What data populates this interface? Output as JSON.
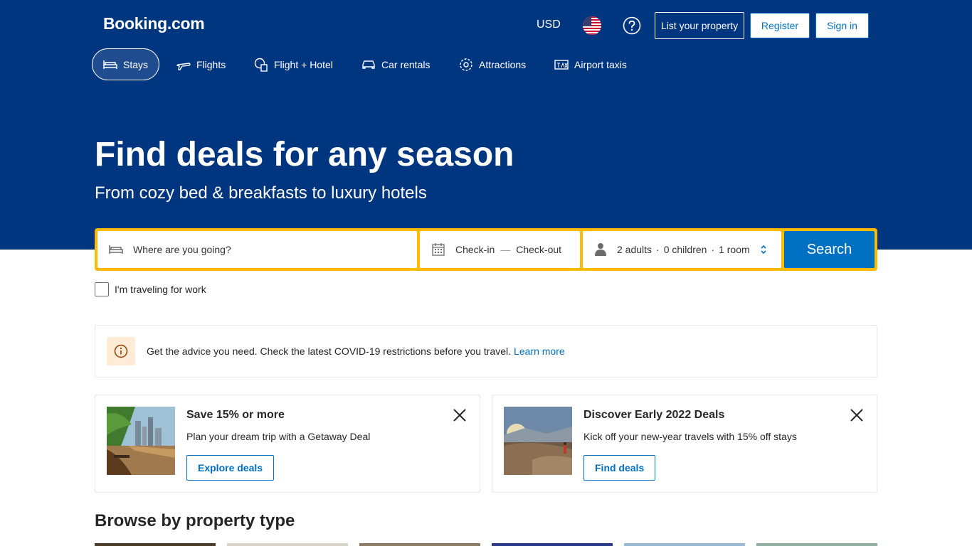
{
  "header": {
    "logo": "Booking.com",
    "currency": "USD",
    "list_property": "List your property",
    "register": "Register",
    "sign_in": "Sign in"
  },
  "nav": {
    "items": [
      {
        "label": "Stays",
        "icon": "bed-icon"
      },
      {
        "label": "Flights",
        "icon": "plane-icon"
      },
      {
        "label": "Flight + Hotel",
        "icon": "flight-hotel-icon"
      },
      {
        "label": "Car rentals",
        "icon": "car-icon"
      },
      {
        "label": "Attractions",
        "icon": "attractions-icon"
      },
      {
        "label": "Airport taxis",
        "icon": "taxi-icon"
      }
    ]
  },
  "hero": {
    "title": "Find deals for any season",
    "subtitle": "From cozy bed & breakfasts to luxury hotels"
  },
  "search": {
    "destination_placeholder": "Where are you going?",
    "checkin": "Check-in",
    "dash": "—",
    "checkout": "Check-out",
    "adults": "2 adults",
    "dot1": "·",
    "children": "0 children",
    "dot2": "·",
    "rooms": "1 room",
    "button": "Search"
  },
  "work_travel": {
    "label": "I'm traveling for work"
  },
  "covid": {
    "text": "Get the advice you need. Check the latest COVID-19 restrictions before you travel.",
    "link": "Learn more"
  },
  "cards": [
    {
      "title": "Save 15% or more",
      "desc": "Plan your dream trip with a Getaway Deal",
      "button": "Explore deals"
    },
    {
      "title": "Discover Early 2022 Deals",
      "desc": "Kick off your new-year travels with 15% off stays",
      "button": "Find deals"
    }
  ],
  "browse": {
    "title": "Browse by property type"
  },
  "colors": {
    "brand_blue": "#003580",
    "accent_blue": "#0071c2",
    "search_yellow": "#febb02"
  }
}
